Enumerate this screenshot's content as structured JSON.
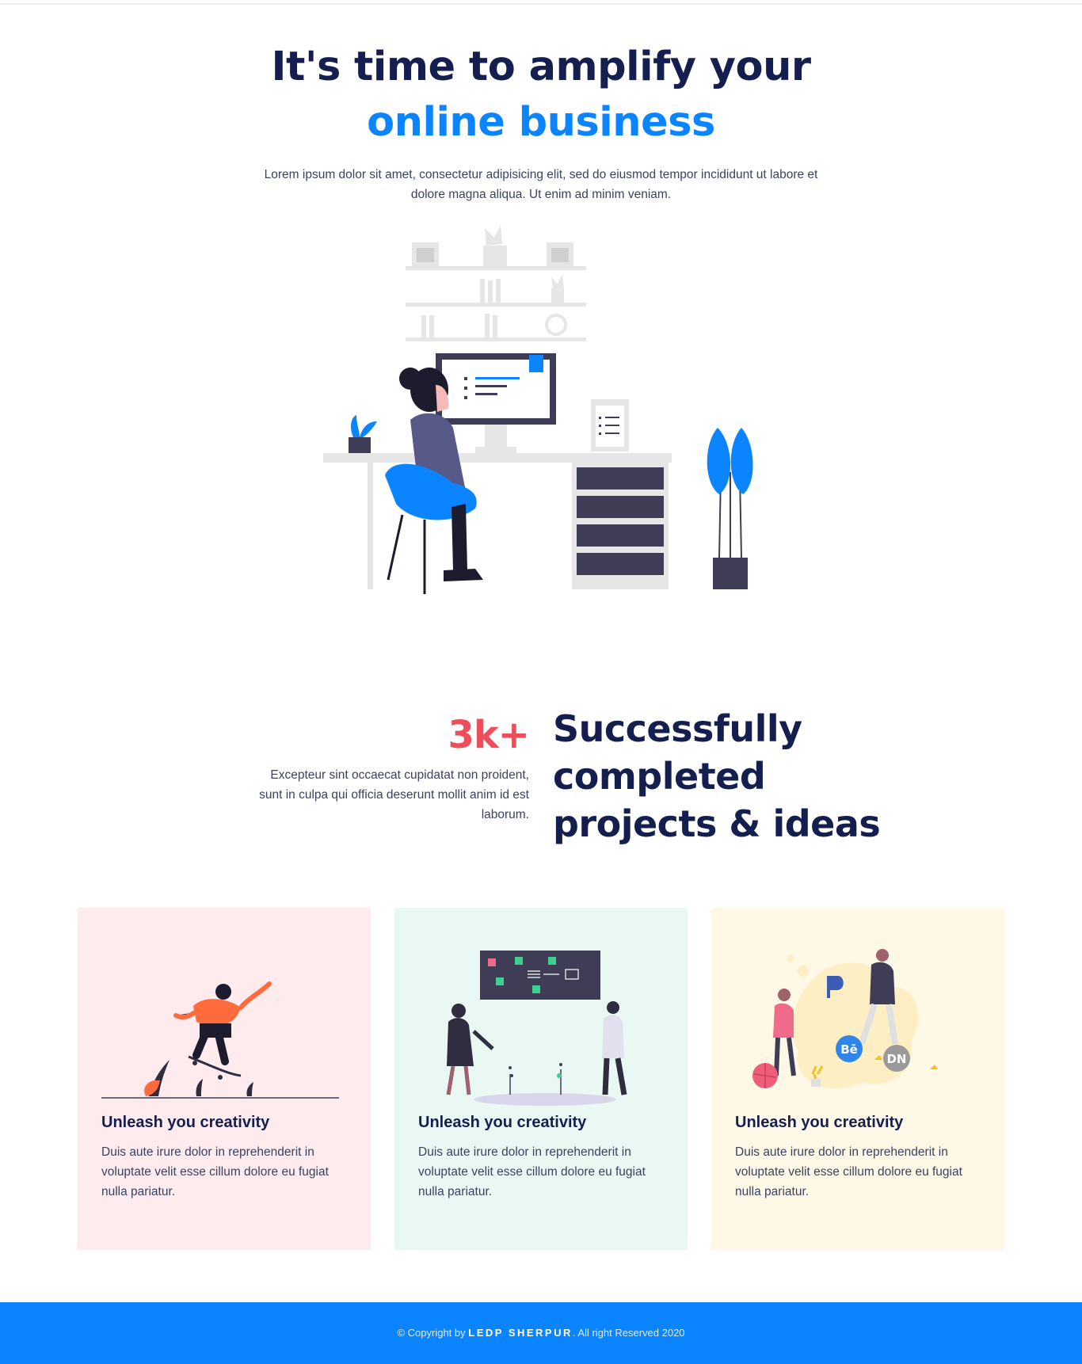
{
  "hero": {
    "title_line1": "It's time to amplify your",
    "title_line2": "online business",
    "description": "Lorem ipsum dolor sit amet, consectetur adipisicing elit, sed do eiusmod tempor incididunt ut labore et dolore magna aliqua. Ut enim ad minim veniam."
  },
  "stats": {
    "number": "3k+",
    "description": "Excepteur sint occaecat cupidatat non proident, sunt in culpa qui officia deserunt mollit anim id est laborum.",
    "headline": "Successfully completed projects & ideas"
  },
  "cards": [
    {
      "title": "Unleash you creativity",
      "text": "Duis aute irure dolor in reprehenderit in voluptate velit esse cillum dolore eu fugiat nulla pariatur.",
      "bg": "#fdebee"
    },
    {
      "title": "Unleash you creativity",
      "text": "Duis aute irure dolor in reprehenderit in voluptate velit esse cillum dolore eu fugiat nulla pariatur.",
      "bg": "#e9f8f3"
    },
    {
      "title": "Unleash you creativity",
      "text": "Duis aute irure dolor in reprehenderit in voluptate velit esse cillum dolore eu fugiat nulla pariatur.",
      "bg": "#fff8e6"
    }
  ],
  "badges": {
    "behance": "Bē",
    "dribbble_dn": "DN"
  },
  "footer": {
    "prefix": "© Copyright by",
    "brand": "LEDP SHERPUR",
    "suffix": ". All right Reserved 2020"
  },
  "colors": {
    "accent": "#0a84ff",
    "navy": "#141f4f",
    "stat": "#ee4e5b"
  }
}
